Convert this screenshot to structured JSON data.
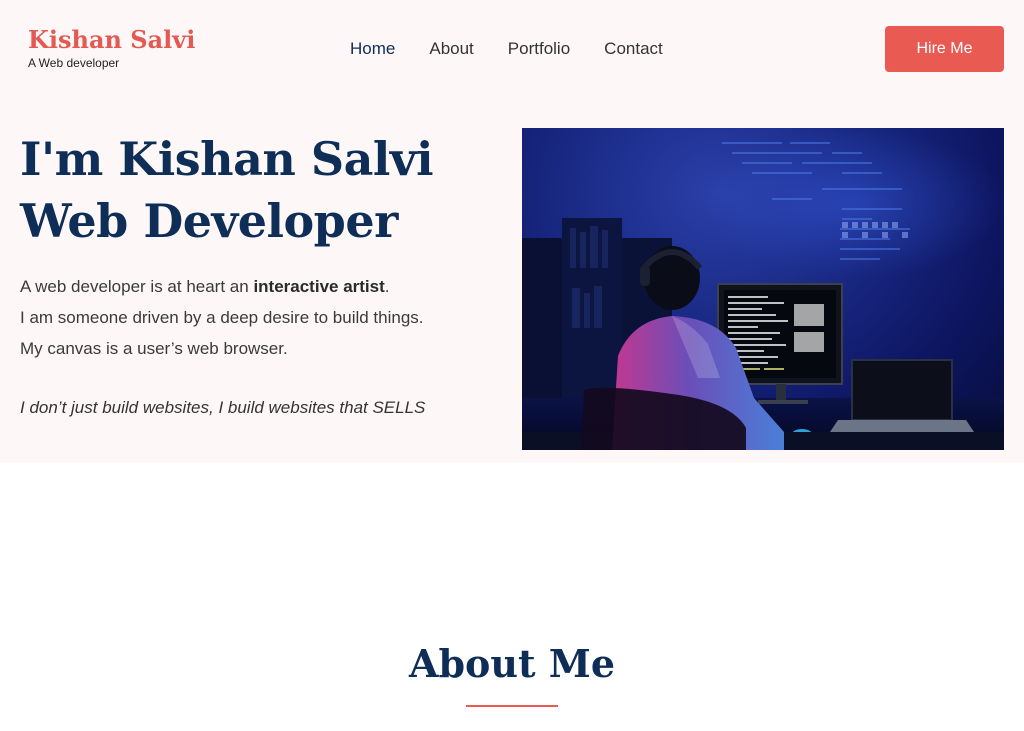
{
  "brand": {
    "name": "Kishan Salvi",
    "tagline": "A Web developer"
  },
  "nav": {
    "items": [
      {
        "label": "Home",
        "active": true
      },
      {
        "label": "About",
        "active": false
      },
      {
        "label": "Portfolio",
        "active": false
      },
      {
        "label": "Contact",
        "active": false
      }
    ]
  },
  "hire_button": "Hire Me",
  "hero": {
    "title_line1": "I'm Kishan Salvi",
    "title_line2": "Web Developer",
    "line1_prefix": "A web developer is at heart an ",
    "line1_bold": "interactive artist",
    "line1_suffix": ".",
    "line2": "I am someone driven by a deep desire to build things.",
    "line3": "My canvas is a user’s web browser.",
    "quote": "I don’t just build websites, I build websites that SELLS",
    "image_subject": "developer at computer in dark blue room"
  },
  "about": {
    "title": "About Me"
  },
  "colors": {
    "accent": "#e85a52",
    "navy": "#0e2e58",
    "hero_bg": "#fdf8f7"
  }
}
